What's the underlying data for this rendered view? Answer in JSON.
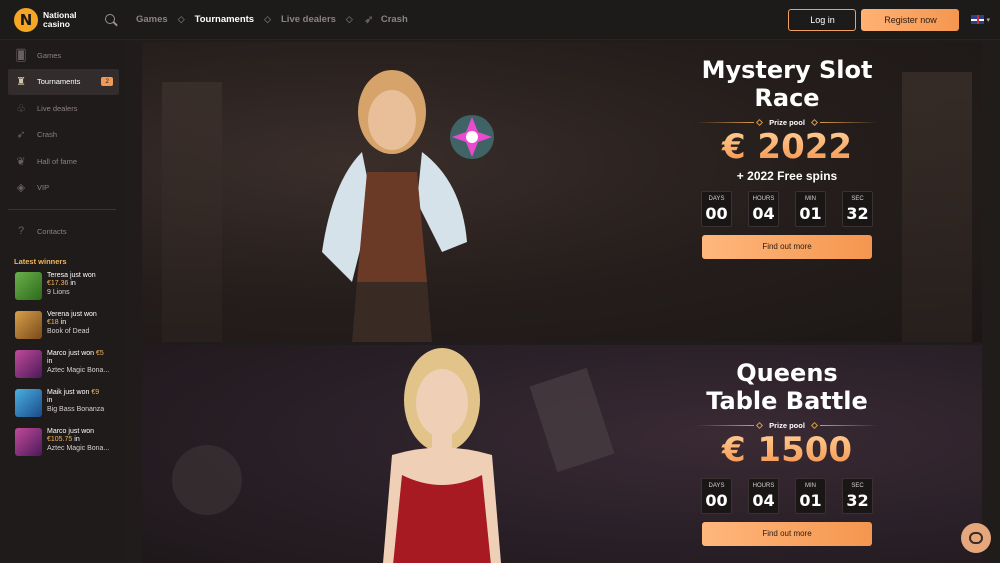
{
  "header": {
    "logo": {
      "line1": "National",
      "line2": "casino",
      "badge": "N"
    },
    "nav": [
      {
        "label": "Games",
        "icon": "diamond-sep"
      },
      {
        "label": "Tournaments",
        "icon": "diamond-sep",
        "active": true
      },
      {
        "label": "Live dealers",
        "icon": "diamond-sep"
      },
      {
        "label": "Crash",
        "icon": "rocket-icon"
      }
    ],
    "login_label": "Log in",
    "register_label": "Register now",
    "language": "EN"
  },
  "sidebar": {
    "items": [
      {
        "label": "Games",
        "icon": "cards-icon"
      },
      {
        "label": "Tournaments",
        "icon": "trophy-icon",
        "badge": "2",
        "active": true
      },
      {
        "label": "Live dealers",
        "icon": "dealer-icon"
      },
      {
        "label": "Crash",
        "icon": "rocket-icon"
      },
      {
        "label": "Hall of fame",
        "icon": "laurel-icon"
      },
      {
        "label": "VIP",
        "icon": "diamond-icon"
      }
    ],
    "contacts_label": "Contacts",
    "winners_title": "Latest winners",
    "winners": [
      {
        "name": "Teresa just won",
        "amount": "€17.36",
        "suffix": " in",
        "game": "9 Lions",
        "color": "#4a8a2a"
      },
      {
        "name": "Verena just won",
        "amount": "€18",
        "suffix": " in",
        "game": "Book of Dead",
        "color": "#b5782a"
      },
      {
        "name": "Marco just won",
        "amount": "€5",
        "suffix": " in",
        "game": "Aztec Magic Bona...",
        "color": "#9a3a7a"
      },
      {
        "name": "Maik just won",
        "amount": "€9",
        "suffix": " in",
        "game": "Big Bass Bonanza",
        "color": "#2a7ab8"
      },
      {
        "name": "Marco just won",
        "amount": "€105.75",
        "suffix": " in",
        "game": "Aztec Magic Bona...",
        "color": "#9a3a7a"
      }
    ]
  },
  "promos": [
    {
      "title": "Mystery Slot Race",
      "prize_label": "Prize pool",
      "amount": "€ 2022",
      "extra": "+ 2022 Free spins",
      "countdown": [
        {
          "label": "DAYS",
          "value": "00"
        },
        {
          "label": "HOURS",
          "value": "04"
        },
        {
          "label": "MIN",
          "value": "01"
        },
        {
          "label": "SEC",
          "value": "32"
        }
      ],
      "cta": "Find out more"
    },
    {
      "title": "Queens Table Battle",
      "prize_label": "Prize pool",
      "amount": "€ 1500",
      "extra": "",
      "countdown": [
        {
          "label": "DAYS",
          "value": "00"
        },
        {
          "label": "HOURS",
          "value": "04"
        },
        {
          "label": "MIN",
          "value": "01"
        },
        {
          "label": "SEC",
          "value": "32"
        }
      ],
      "cta": "Find out more"
    }
  ],
  "colors": {
    "accent": "#f4964f",
    "gold": "#f5b65a",
    "bg": "#1a1717"
  }
}
